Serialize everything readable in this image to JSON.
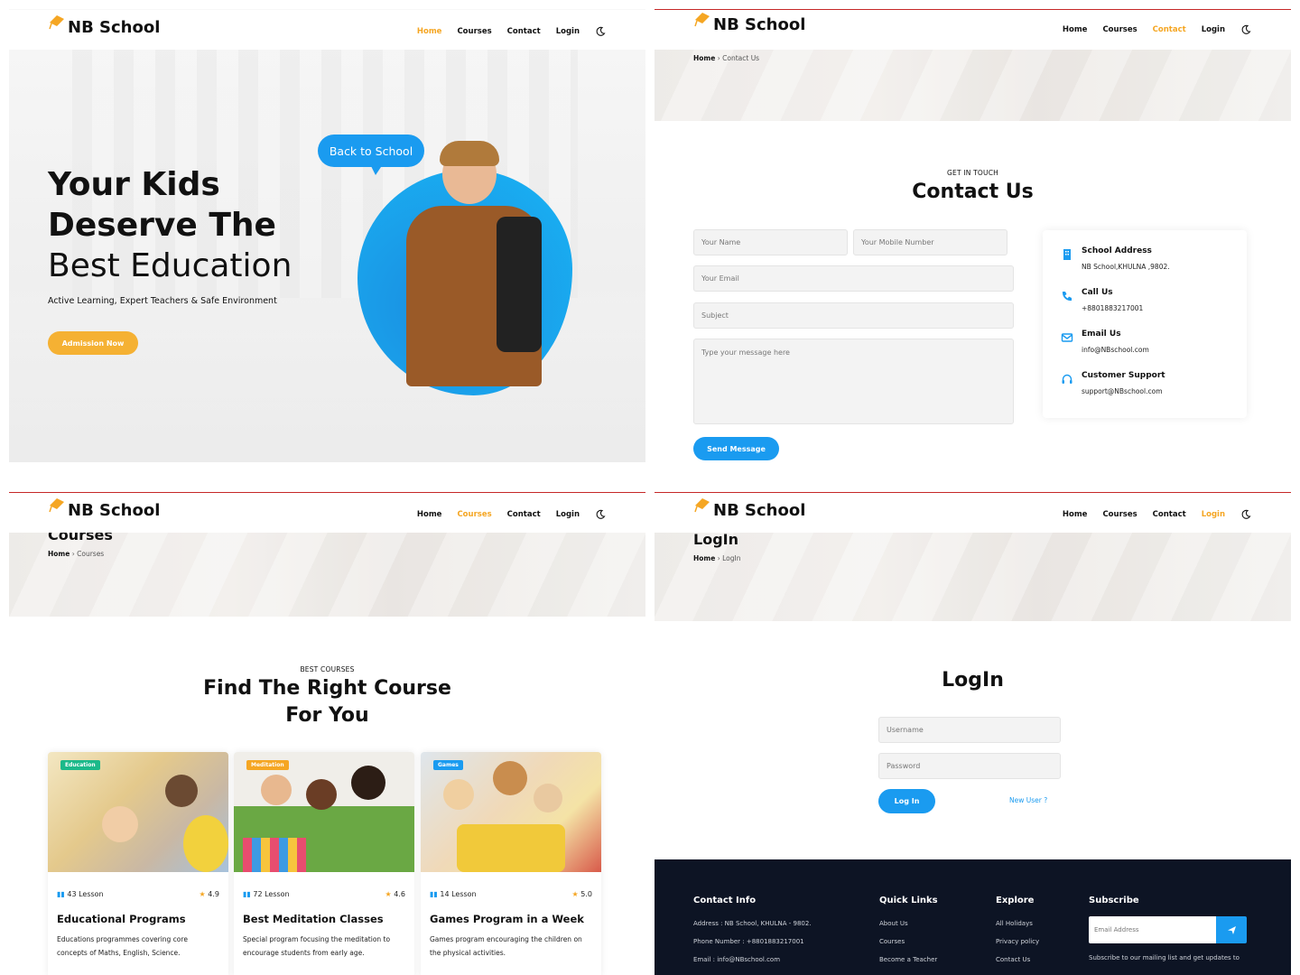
{
  "brand": {
    "name": "NB School",
    "accent": "#f5a623",
    "blue": "#1a9bf0"
  },
  "nav": {
    "home": "Home",
    "courses": "Courses",
    "contact": "Contact",
    "login": "Login",
    "theme_icon": "moon-icon"
  },
  "hero": {
    "line1": "Your Kids",
    "line2": "Deserve The",
    "line3": "Best Education",
    "subtitle": "Active Learning, Expert Teachers & Safe Environment",
    "cta": "Admission Now",
    "bubble": "Back to School"
  },
  "contact": {
    "breadcrumb_home": "Home",
    "breadcrumb_current": "Contact Us",
    "eyebrow": "GET IN TOUCH",
    "title": "Contact Us",
    "form": {
      "name_placeholder": "Your Name",
      "mobile_placeholder": "Your Mobile Number",
      "email_placeholder": "Your Email",
      "subject_placeholder": "Subject",
      "message_placeholder": "Type your message here",
      "submit": "Send Message"
    },
    "info": [
      {
        "icon": "building-icon",
        "title": "School Address",
        "value": "NB School,KHULNA ,9802."
      },
      {
        "icon": "phone-icon",
        "title": "Call Us",
        "value": "+8801883217001"
      },
      {
        "icon": "email-icon",
        "title": "Email Us",
        "value": "info@NBschool.com"
      },
      {
        "icon": "headset-icon",
        "title": "Customer Support",
        "value": "support@NBschool.com"
      }
    ]
  },
  "courses": {
    "page_title": "Courses",
    "breadcrumb_home": "Home",
    "breadcrumb_current": "Courses",
    "eyebrow": "BEST COURSES",
    "title_line1": "Find The Right Course",
    "title_line2": "For You",
    "items": [
      {
        "tag": "Education",
        "tag_color": "#1bb98a",
        "lessons": "43 Lesson",
        "rating": "4.9",
        "title": "Educational Programs",
        "desc_line1": "Educations programmes covering core",
        "desc_line2": "concepts of Maths, English, Science."
      },
      {
        "tag": "Meditation",
        "tag_color": "#f5a623",
        "lessons": "72 Lesson",
        "rating": "4.6",
        "title": "Best Meditation Classes",
        "desc_line1": "Special program focusing the meditation to",
        "desc_line2": "encourage students from early age."
      },
      {
        "tag": "Games",
        "tag_color": "#1a9bf0",
        "lessons": "14 Lesson",
        "rating": "5.0",
        "title": "Games Program in a Week",
        "desc_line1": "Games program encouraging the children on",
        "desc_line2": "the physical activities."
      }
    ]
  },
  "login": {
    "page_title": "LogIn",
    "breadcrumb_home": "Home",
    "breadcrumb_current": "LogIn",
    "title": "LogIn",
    "username_placeholder": "Username",
    "password_placeholder": "Password",
    "submit": "Log In",
    "new_user": "New User ?"
  },
  "footer": {
    "contact_title": "Contact Info",
    "address": "Address : NB School, KHULNA - 9802.",
    "phone": "Phone Number : +8801883217001",
    "email": "Email : info@NBschool.com",
    "quick_title": "Quick Links",
    "quick": [
      "About Us",
      "Courses",
      "Become a Teacher"
    ],
    "explore_title": "Explore",
    "explore": [
      "All Holidays",
      "Privacy policy",
      "Contact Us"
    ],
    "subscribe_title": "Subscribe",
    "subscribe_placeholder": "Email Address",
    "subscribe_note": "Subscribe to our mailing list and get updates to"
  }
}
